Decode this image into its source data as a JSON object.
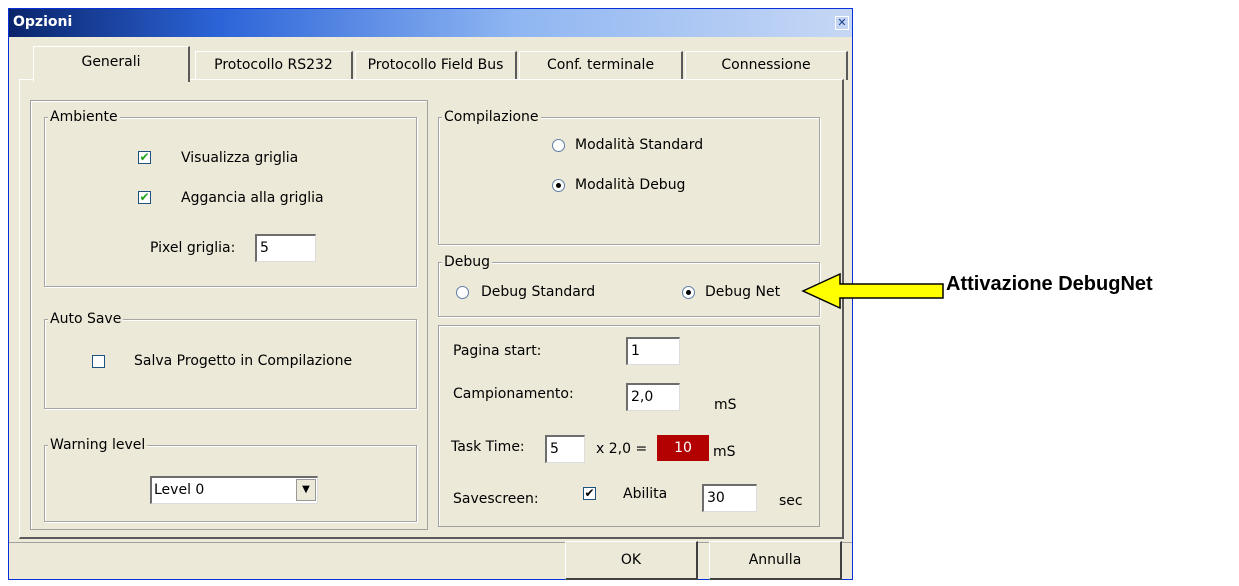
{
  "window": {
    "title": "Opzioni",
    "close_glyph": "✕"
  },
  "tabs": [
    {
      "label": "Generali",
      "active": true
    },
    {
      "label": "Protocollo RS232"
    },
    {
      "label": "Protocollo Field Bus"
    },
    {
      "label": "Conf. terminale"
    },
    {
      "label": "Connessione"
    }
  ],
  "ambiente": {
    "legend": "Ambiente",
    "visualizza_label": "Visualizza griglia",
    "visualizza_checked": true,
    "aggancia_label": "Aggancia alla griglia",
    "aggancia_checked": true,
    "pixel_label": "Pixel griglia:",
    "pixel_value": "5"
  },
  "autosave": {
    "legend": "Auto Save",
    "salva_label": "Salva Progetto in Compilazione",
    "salva_checked": false
  },
  "warning": {
    "legend": "Warning level",
    "selected": "Level 0"
  },
  "compilazione": {
    "legend": "Compilazione",
    "standard_label": "Modalità Standard",
    "debug_label": "Modalità Debug",
    "selected": "debug"
  },
  "debug": {
    "legend": "Debug",
    "standard_label": "Debug Standard",
    "net_label": "Debug Net",
    "selected": "net"
  },
  "settings": {
    "pagina_label": "Pagina start:",
    "pagina_value": "1",
    "campionamento_label": "Campionamento:",
    "campionamento_value": "2,0",
    "campionamento_unit": "mS",
    "task_label": "Task Time:",
    "task_value": "5",
    "task_mult": "x 2,0 =",
    "task_result": "10",
    "task_unit": "mS",
    "savescreen_label": "Savescreen:",
    "abilita_label": "Abilita",
    "abilita_checked": true,
    "savescreen_value": "30",
    "savescreen_unit": "sec"
  },
  "buttons": {
    "ok": "OK",
    "annulla": "Annulla"
  },
  "annotation": {
    "label": "Attivazione DebugNet",
    "arrow_color": "#ffff00"
  },
  "colors": {
    "title_bar": "#0a246a",
    "window_bg": "#ece9d8",
    "task_result_bg": "#b30000"
  }
}
